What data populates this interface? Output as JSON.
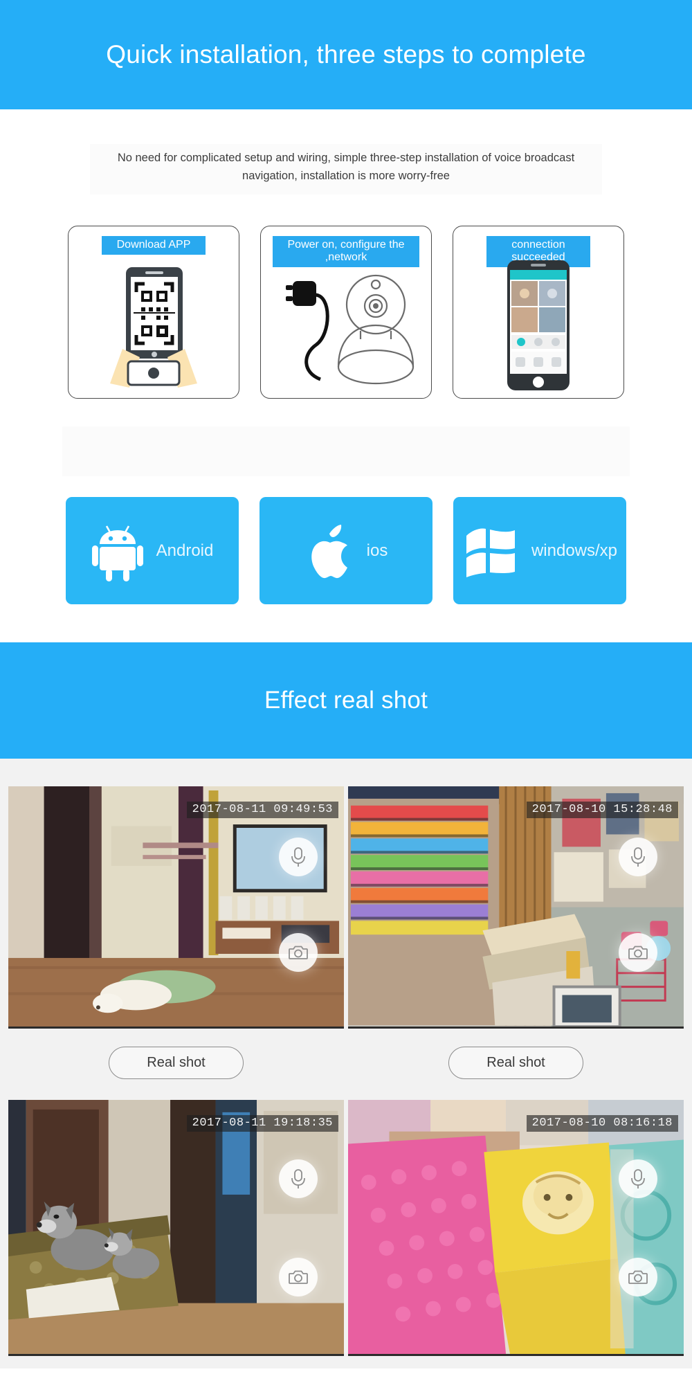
{
  "sections": {
    "install": {
      "banner_title": "Quick installation, three steps to complete",
      "intro": "No need for complicated setup and wiring, simple three-step installation of voice broadcast navigation, installation is more worry-free",
      "accent_color": "#25aef7",
      "steps": [
        {
          "label": "Download APP",
          "art": "tablet-qrcode-hands-icon"
        },
        {
          "label": "Power on, configure the\n,network",
          "art": "power-plug-camera-icon"
        },
        {
          "label": "connection\nsucceeded",
          "art": "smartphone-live-view-icon"
        }
      ],
      "platforms": [
        {
          "label": "Android",
          "icon": "android-robot-icon",
          "bg": "#2ab7f5"
        },
        {
          "label": "ios",
          "icon": "apple-logo-icon",
          "bg": "#2ab7f5"
        },
        {
          "label": "windows/xp",
          "icon": "windows-flag-icon",
          "bg": "#2ab7f5"
        }
      ]
    },
    "gallery": {
      "banner_title": "Effect real shot",
      "accent_color": "#25aef7",
      "shots": [
        {
          "timestamp": "2017-08-11 09:49:53",
          "scene": "hallway-dog-on-bed",
          "mic_icon": "microphone-icon",
          "camera_icon": "camera-icon"
        },
        {
          "timestamp": "2017-08-10 15:28:48",
          "scene": "convenience-store-aisle",
          "mic_icon": "microphone-icon",
          "camera_icon": "camera-icon"
        },
        {
          "timestamp": "2017-08-11 19:18:35",
          "scene": "living-room-two-dogs-sofa",
          "mic_icon": "microphone-icon",
          "camera_icon": "camera-icon"
        },
        {
          "timestamp": "2017-08-10 08:16:18",
          "scene": "bedroom-pink-blanket-baby",
          "mic_icon": "microphone-icon",
          "camera_icon": "camera-icon"
        }
      ],
      "buttons": [
        {
          "label": "Real shot"
        },
        {
          "label": "Real shot"
        }
      ]
    }
  }
}
